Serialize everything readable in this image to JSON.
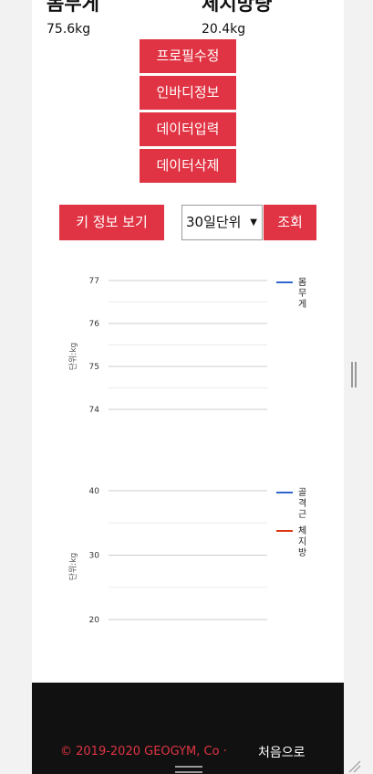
{
  "stats": {
    "weight": {
      "label": "몸무게",
      "value": "75.6kg"
    },
    "body_fat": {
      "label": "체지방량",
      "value": "20.4kg"
    }
  },
  "actions": {
    "profile_edit": "프로필수정",
    "inbody_info": "인바디정보",
    "data_input": "데이터입력",
    "data_delete": "데이터삭제"
  },
  "toolbar": {
    "key_info_label": "키 정보 보기",
    "period_selected": "30일단위",
    "query_label": "조회"
  },
  "colors": {
    "accent": "#e03444",
    "blue_series": "#3366cc",
    "red_series": "#dc3912"
  },
  "chart_data": [
    {
      "type": "line",
      "ylabel": "단위:kg",
      "ylim": [
        74,
        77
      ],
      "yticks": [
        "77",
        "76",
        "75",
        "74"
      ],
      "grid": true,
      "legend": "right",
      "series": [
        {
          "name": "몸무게",
          "color": "#3366cc",
          "values": []
        }
      ]
    },
    {
      "type": "line",
      "ylabel": "단위:kg",
      "ylim": [
        20,
        40
      ],
      "yticks": [
        "40",
        "30",
        "20"
      ],
      "grid": true,
      "legend": "right",
      "series": [
        {
          "name": "골격근",
          "color": "#3366cc",
          "values": []
        },
        {
          "name": "체지방",
          "color": "#dc3912",
          "values": []
        }
      ]
    }
  ],
  "footer": {
    "copyright": "© 2019-2020 GEOGYM, Co ·",
    "home_link": "처음으로"
  },
  "icons": {
    "select_caret": "caret-down-icon",
    "side_handle": "drag-handle-icon",
    "bottom_handle": "drag-handle-icon",
    "resize": "resize-grip-icon"
  }
}
